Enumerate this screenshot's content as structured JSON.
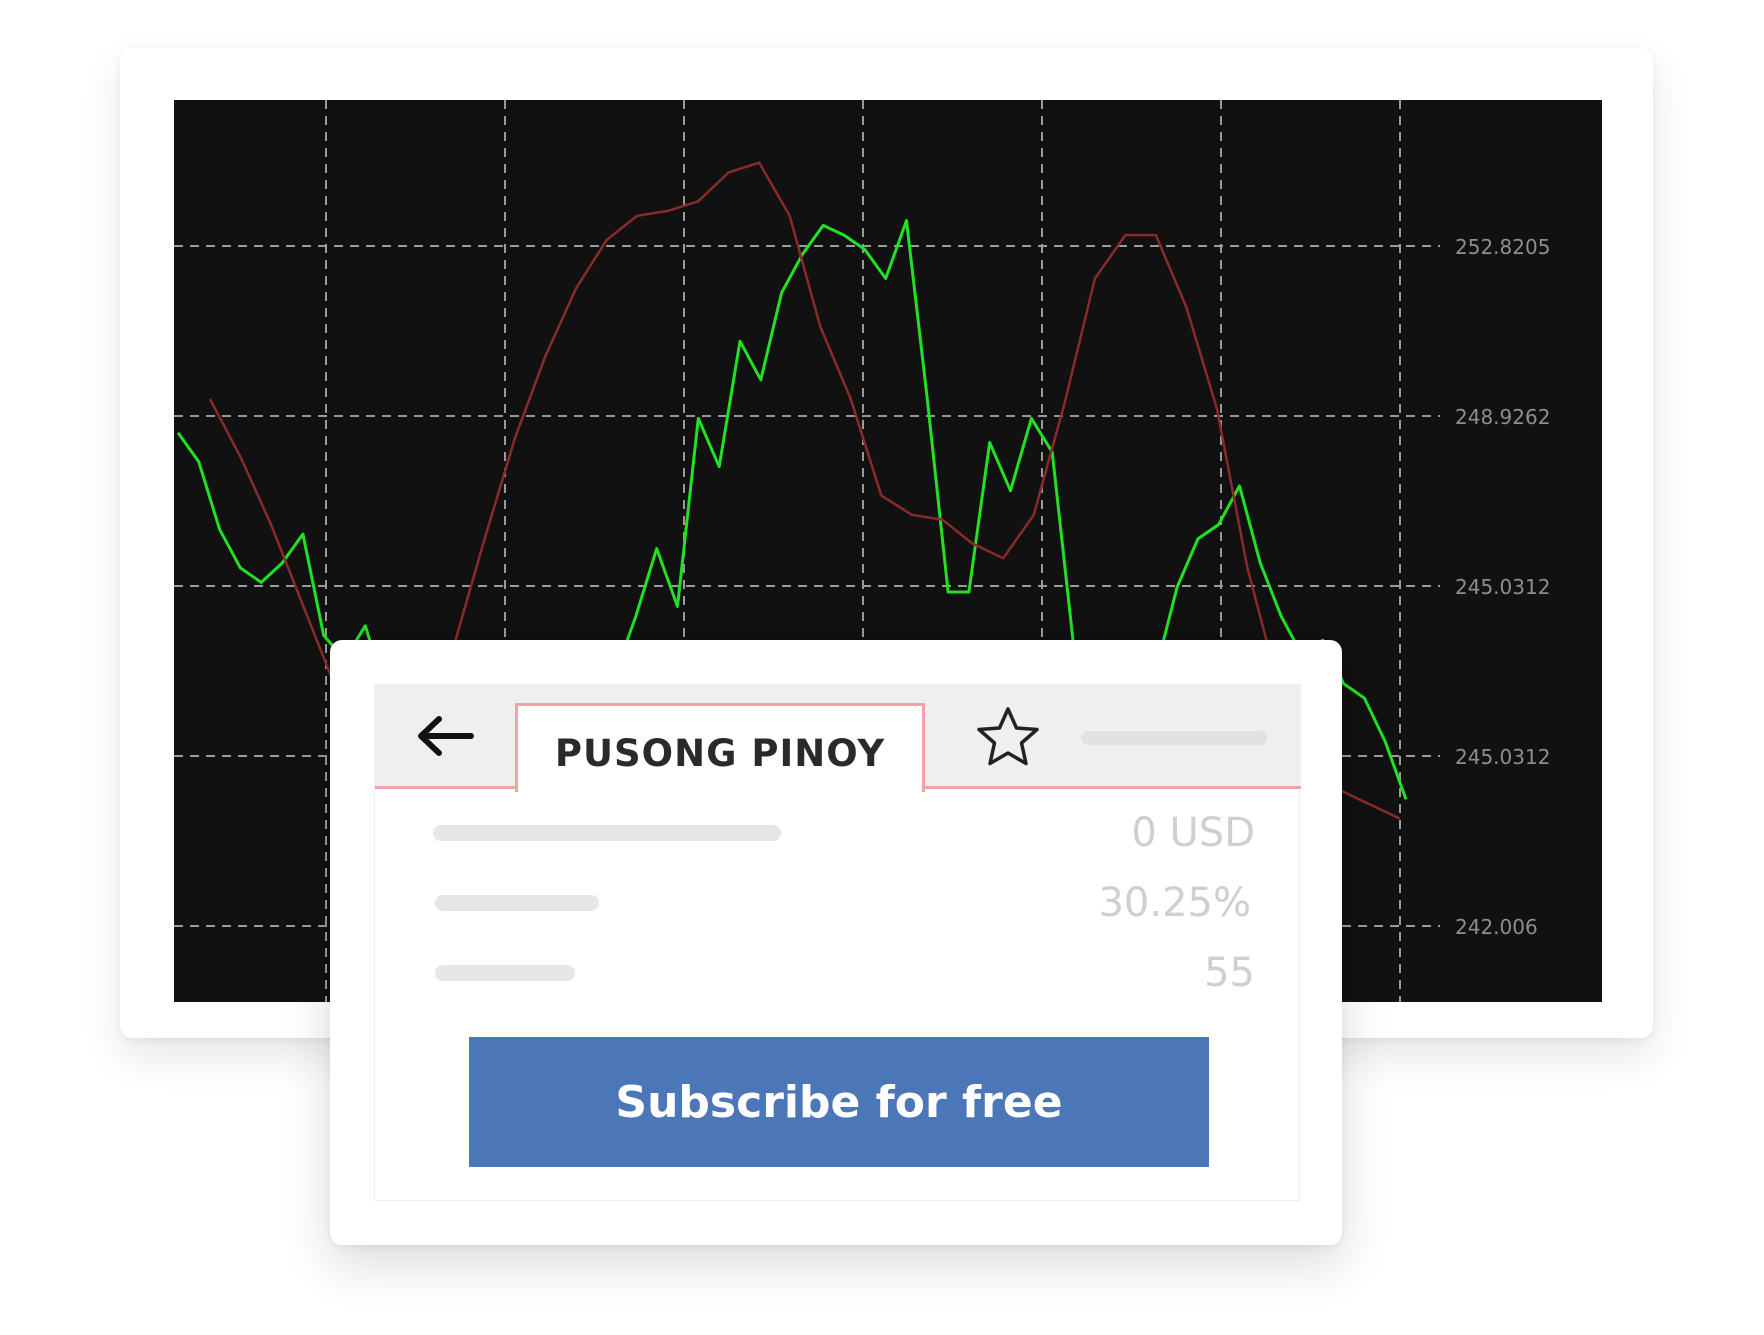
{
  "chart_data": {
    "type": "line",
    "y_tick_labels": [
      "252.8205",
      "248.9262",
      "245.0312",
      "245.0312",
      "242.006"
    ],
    "series": [
      {
        "color": "#22e022",
        "values": [
          248.3,
          247.7,
          246.3,
          245.5,
          245.2,
          245.6,
          246.2,
          244.1,
          243.6,
          244.3,
          242.9,
          241.8,
          239.4,
          238.2,
          237.2,
          237.4,
          237.9,
          238.4,
          239.4,
          240.4,
          241.5,
          243.3,
          244.5,
          245.9,
          244.7,
          248.6,
          247.6,
          250.2,
          249.4,
          251.2,
          252.0,
          252.6,
          252.4,
          252.1,
          251.5,
          252.7,
          249.0,
          245.0,
          245.0,
          248.1,
          247.1,
          248.6,
          247.9,
          244.0,
          242.5,
          240.9,
          241.5,
          243.4,
          245.1,
          246.1,
          246.4,
          247.2,
          245.6,
          244.5,
          243.7,
          244.0,
          243.1,
          242.8,
          241.9,
          240.7
        ]
      },
      {
        "color": "#8b2a2a",
        "values": [
          249.0,
          247.8,
          246.4,
          244.8,
          243.2,
          241.8,
          241.2,
          242.0,
          243.9,
          246.1,
          248.2,
          249.9,
          251.3,
          252.3,
          252.8,
          252.9,
          253.1,
          253.7,
          253.9,
          252.8,
          250.5,
          249.0,
          247.0,
          246.6,
          246.5,
          246.0,
          245.7,
          246.6,
          248.9,
          251.5,
          252.4,
          252.4,
          250.9,
          248.8,
          245.5,
          243.1,
          242.0,
          240.9,
          240.6,
          240.3
        ]
      }
    ]
  },
  "panel": {
    "tab_title": "PUSONG PINOY",
    "rows": [
      {
        "value": "0 USD"
      },
      {
        "value": "30.25%"
      },
      {
        "value": "55"
      }
    ],
    "subscribe_label": "Subscribe for free"
  }
}
